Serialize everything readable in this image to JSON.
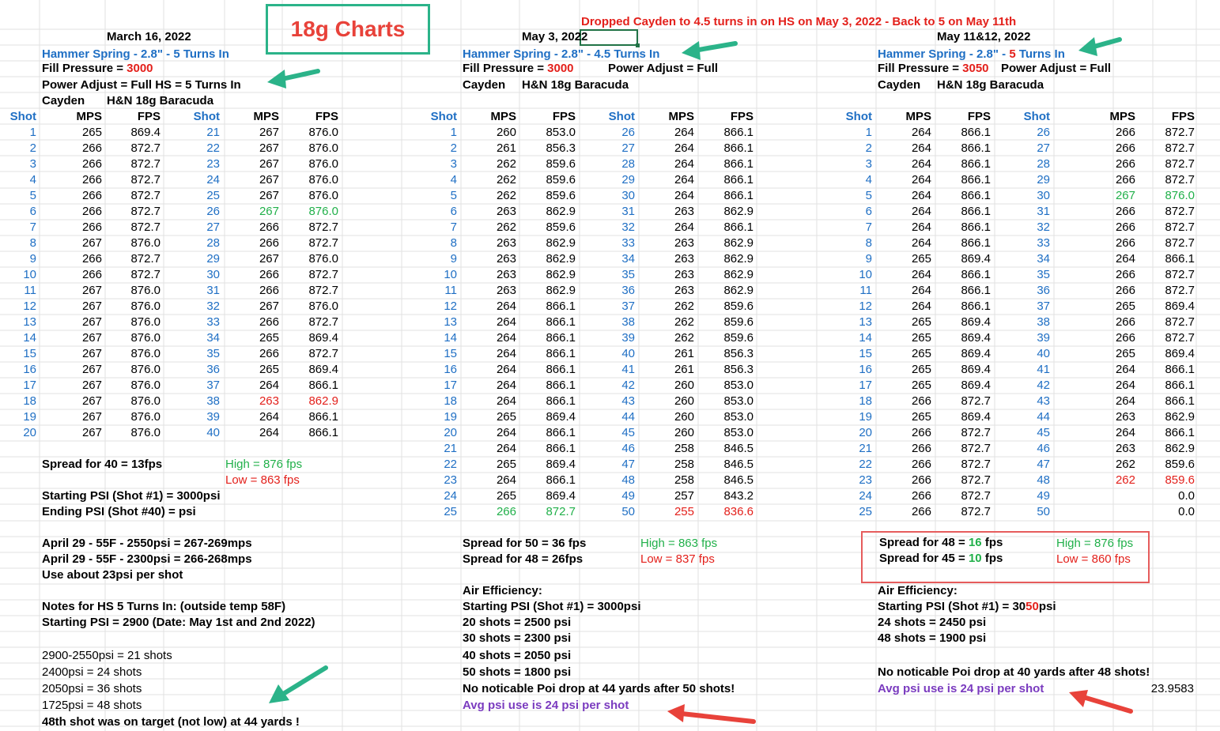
{
  "title": "18g Charts",
  "banner": "Dropped Cayden to 4.5 turns in on HS on May 3, 2022 - Back to 5 on May 11th",
  "colors": {
    "blue": "#1f6fc4",
    "red": "#e3201b",
    "green": "#21b04a",
    "purple": "#7a3bbf",
    "arrow_green": "#2bb389",
    "arrow_red": "#e8423a"
  },
  "s1": {
    "date": "March 16, 2022",
    "hammer": "Hammer Spring - 2.8\" - 5 Turns In",
    "fill_label": "Fill Pressure = ",
    "fill_value": "3000",
    "power": "Power Adjust = Full  HS = 5 Turns In",
    "gun": "Cayden",
    "pellet": "H&N 18g Baracuda",
    "headers": [
      "Shot",
      "MPS",
      "FPS",
      "Shot",
      "MPS",
      "FPS"
    ],
    "rows": [
      [
        "1",
        "265",
        "869.4",
        "21",
        "267",
        "876.0"
      ],
      [
        "2",
        "266",
        "872.7",
        "22",
        "267",
        "876.0"
      ],
      [
        "3",
        "266",
        "872.7",
        "23",
        "267",
        "876.0"
      ],
      [
        "4",
        "266",
        "872.7",
        "24",
        "267",
        "876.0"
      ],
      [
        "5",
        "266",
        "872.7",
        "25",
        "267",
        "876.0"
      ],
      [
        "6",
        "266",
        "872.7",
        "26",
        "267",
        "876.0"
      ],
      [
        "7",
        "266",
        "872.7",
        "27",
        "266",
        "872.7"
      ],
      [
        "8",
        "267",
        "876.0",
        "28",
        "266",
        "872.7"
      ],
      [
        "9",
        "266",
        "872.7",
        "29",
        "267",
        "876.0"
      ],
      [
        "10",
        "266",
        "872.7",
        "30",
        "266",
        "872.7"
      ],
      [
        "11",
        "267",
        "876.0",
        "31",
        "266",
        "872.7"
      ],
      [
        "12",
        "267",
        "876.0",
        "32",
        "267",
        "876.0"
      ],
      [
        "13",
        "267",
        "876.0",
        "33",
        "266",
        "872.7"
      ],
      [
        "14",
        "267",
        "876.0",
        "34",
        "265",
        "869.4"
      ],
      [
        "15",
        "267",
        "876.0",
        "35",
        "266",
        "872.7"
      ],
      [
        "16",
        "267",
        "876.0",
        "36",
        "265",
        "869.4"
      ],
      [
        "17",
        "267",
        "876.0",
        "37",
        "264",
        "866.1"
      ],
      [
        "18",
        "267",
        "876.0",
        "38",
        "263",
        "862.9"
      ],
      [
        "19",
        "267",
        "876.0",
        "39",
        "264",
        "866.1"
      ],
      [
        "20",
        "267",
        "876.0",
        "40",
        "264",
        "866.1"
      ]
    ],
    "spread": "Spread for 40 = 13fps",
    "high": "High = 876 fps",
    "low": "Low = 863 fps",
    "start_psi": "Starting PSI (Shot #1) = 3000psi",
    "end_psi": "Ending PSI (Shot #40) = psi",
    "april1": "April 29 - 55F - 2550psi = 267-269mps",
    "april2": "April 29 - 55F - 2300psi = 266-268mps",
    "use": "Use about 23psi per shot",
    "notes": "Notes for HS 5 Turns In: (outside temp 58F)",
    "notes_start": "Starting PSI = 2900 (Date: May 1st and 2nd 2022)",
    "psi_lines": [
      "2900-2550psi = 21 shots",
      "2400psi = 24 shots",
      "2050psi = 36 shots",
      "1725psi = 48 shots"
    ],
    "target": "48th shot was on target (not low) at 44 yards !"
  },
  "s2": {
    "date": "May 3, 2022",
    "hammer": "Hammer Spring - 2.8\" - 4.5 Turns In",
    "fill_label": "Fill Pressure = ",
    "fill_value": "3000",
    "power": "Power Adjust = Full",
    "gun": "Cayden",
    "pellet": "H&N 18g Baracuda",
    "headers": [
      "Shot",
      "MPS",
      "FPS",
      "Shot",
      "MPS",
      "FPS"
    ],
    "rows": [
      [
        "1",
        "260",
        "853.0",
        "26",
        "264",
        "866.1"
      ],
      [
        "2",
        "261",
        "856.3",
        "27",
        "264",
        "866.1"
      ],
      [
        "3",
        "262",
        "859.6",
        "28",
        "264",
        "866.1"
      ],
      [
        "4",
        "262",
        "859.6",
        "29",
        "264",
        "866.1"
      ],
      [
        "5",
        "262",
        "859.6",
        "30",
        "264",
        "866.1"
      ],
      [
        "6",
        "263",
        "862.9",
        "31",
        "263",
        "862.9"
      ],
      [
        "7",
        "262",
        "859.6",
        "32",
        "264",
        "866.1"
      ],
      [
        "8",
        "263",
        "862.9",
        "33",
        "263",
        "862.9"
      ],
      [
        "9",
        "263",
        "862.9",
        "34",
        "263",
        "862.9"
      ],
      [
        "10",
        "263",
        "862.9",
        "35",
        "263",
        "862.9"
      ],
      [
        "11",
        "263",
        "862.9",
        "36",
        "263",
        "862.9"
      ],
      [
        "12",
        "264",
        "866.1",
        "37",
        "262",
        "859.6"
      ],
      [
        "13",
        "264",
        "866.1",
        "38",
        "262",
        "859.6"
      ],
      [
        "14",
        "264",
        "866.1",
        "39",
        "262",
        "859.6"
      ],
      [
        "15",
        "264",
        "866.1",
        "40",
        "261",
        "856.3"
      ],
      [
        "16",
        "264",
        "866.1",
        "41",
        "261",
        "856.3"
      ],
      [
        "17",
        "264",
        "866.1",
        "42",
        "260",
        "853.0"
      ],
      [
        "18",
        "264",
        "866.1",
        "43",
        "260",
        "853.0"
      ],
      [
        "19",
        "265",
        "869.4",
        "44",
        "260",
        "853.0"
      ],
      [
        "20",
        "264",
        "866.1",
        "45",
        "260",
        "853.0"
      ],
      [
        "21",
        "264",
        "866.1",
        "46",
        "258",
        "846.5"
      ],
      [
        "22",
        "265",
        "869.4",
        "47",
        "258",
        "846.5"
      ],
      [
        "23",
        "264",
        "866.1",
        "48",
        "258",
        "846.5"
      ],
      [
        "24",
        "265",
        "869.4",
        "49",
        "257",
        "843.2"
      ],
      [
        "25",
        "266",
        "872.7",
        "50",
        "255",
        "836.6"
      ]
    ],
    "spread50": "Spread for 50 = 36 fps",
    "spread48": "Spread for 48 =  26fps",
    "high": "High = 863 fps",
    "low": "Low = 837 fps",
    "air": "Air Efficiency:",
    "start_psi": "Starting PSI (Shot #1) = 3000psi",
    "shots": [
      "20 shots = 2500 psi",
      "30 shots = 2300 psi",
      "40 shots = 2050 psi",
      "50 shots = 1800 psi"
    ],
    "poi": "No noticable Poi drop at 44 yards after 50 shots!",
    "avg": "Avg psi use is 24 psi per shot"
  },
  "s3": {
    "date": "May 11&12, 2022",
    "hammer_a": "Hammer Spring - 2.8\" - ",
    "hammer_b": "5",
    "hammer_c": " Turns In",
    "fill_label": "Fill Pressure = ",
    "fill_value": "3050",
    "power": "Power Adjust = Full",
    "gun": "Cayden",
    "pellet": "H&N 18g Baracuda",
    "headers": [
      "Shot",
      "MPS",
      "FPS",
      "Shot",
      "MPS",
      "FPS"
    ],
    "rows": [
      [
        "1",
        "264",
        "866.1",
        "26",
        "266",
        "872.7"
      ],
      [
        "2",
        "264",
        "866.1",
        "27",
        "266",
        "872.7"
      ],
      [
        "3",
        "264",
        "866.1",
        "28",
        "266",
        "872.7"
      ],
      [
        "4",
        "264",
        "866.1",
        "29",
        "266",
        "872.7"
      ],
      [
        "5",
        "264",
        "866.1",
        "30",
        "267",
        "876.0"
      ],
      [
        "6",
        "264",
        "866.1",
        "31",
        "266",
        "872.7"
      ],
      [
        "7",
        "264",
        "866.1",
        "32",
        "266",
        "872.7"
      ],
      [
        "8",
        "264",
        "866.1",
        "33",
        "266",
        "872.7"
      ],
      [
        "9",
        "265",
        "869.4",
        "34",
        "264",
        "866.1"
      ],
      [
        "10",
        "264",
        "866.1",
        "35",
        "266",
        "872.7"
      ],
      [
        "11",
        "264",
        "866.1",
        "36",
        "266",
        "872.7"
      ],
      [
        "12",
        "264",
        "866.1",
        "37",
        "265",
        "869.4"
      ],
      [
        "13",
        "265",
        "869.4",
        "38",
        "266",
        "872.7"
      ],
      [
        "14",
        "265",
        "869.4",
        "39",
        "266",
        "872.7"
      ],
      [
        "15",
        "265",
        "869.4",
        "40",
        "265",
        "869.4"
      ],
      [
        "16",
        "265",
        "869.4",
        "41",
        "264",
        "866.1"
      ],
      [
        "17",
        "265",
        "869.4",
        "42",
        "264",
        "866.1"
      ],
      [
        "18",
        "266",
        "872.7",
        "43",
        "264",
        "866.1"
      ],
      [
        "19",
        "265",
        "869.4",
        "44",
        "263",
        "862.9"
      ],
      [
        "20",
        "266",
        "872.7",
        "45",
        "264",
        "866.1"
      ],
      [
        "21",
        "266",
        "872.7",
        "46",
        "263",
        "862.9"
      ],
      [
        "22",
        "266",
        "872.7",
        "47",
        "262",
        "859.6"
      ],
      [
        "23",
        "266",
        "872.7",
        "48",
        "262",
        "859.6"
      ],
      [
        "24",
        "266",
        "872.7",
        "49",
        "",
        "0.0"
      ],
      [
        "25",
        "266",
        "872.7",
        "50",
        "",
        "0.0"
      ]
    ],
    "spread48_a": "Spread for 48 = ",
    "spread48_b": "16",
    "spread48_c": " fps",
    "spread45_a": "Spread for 45 = ",
    "spread45_b": "10",
    "spread45_c": " fps",
    "high": "High = 876 fps",
    "low": "Low = 860 fps",
    "air": "Air Efficiency:",
    "start_a": "Starting PSI (Shot #1) = 30",
    "start_b": "50",
    "start_c": "psi",
    "shots": [
      "24 shots = 2450 psi",
      "48 shots = 1900 psi"
    ],
    "poi": "No noticable Poi drop at 40 yards after 48 shots!",
    "avg": "Avg psi use is 24 psi per shot",
    "calc": "23.9583"
  }
}
